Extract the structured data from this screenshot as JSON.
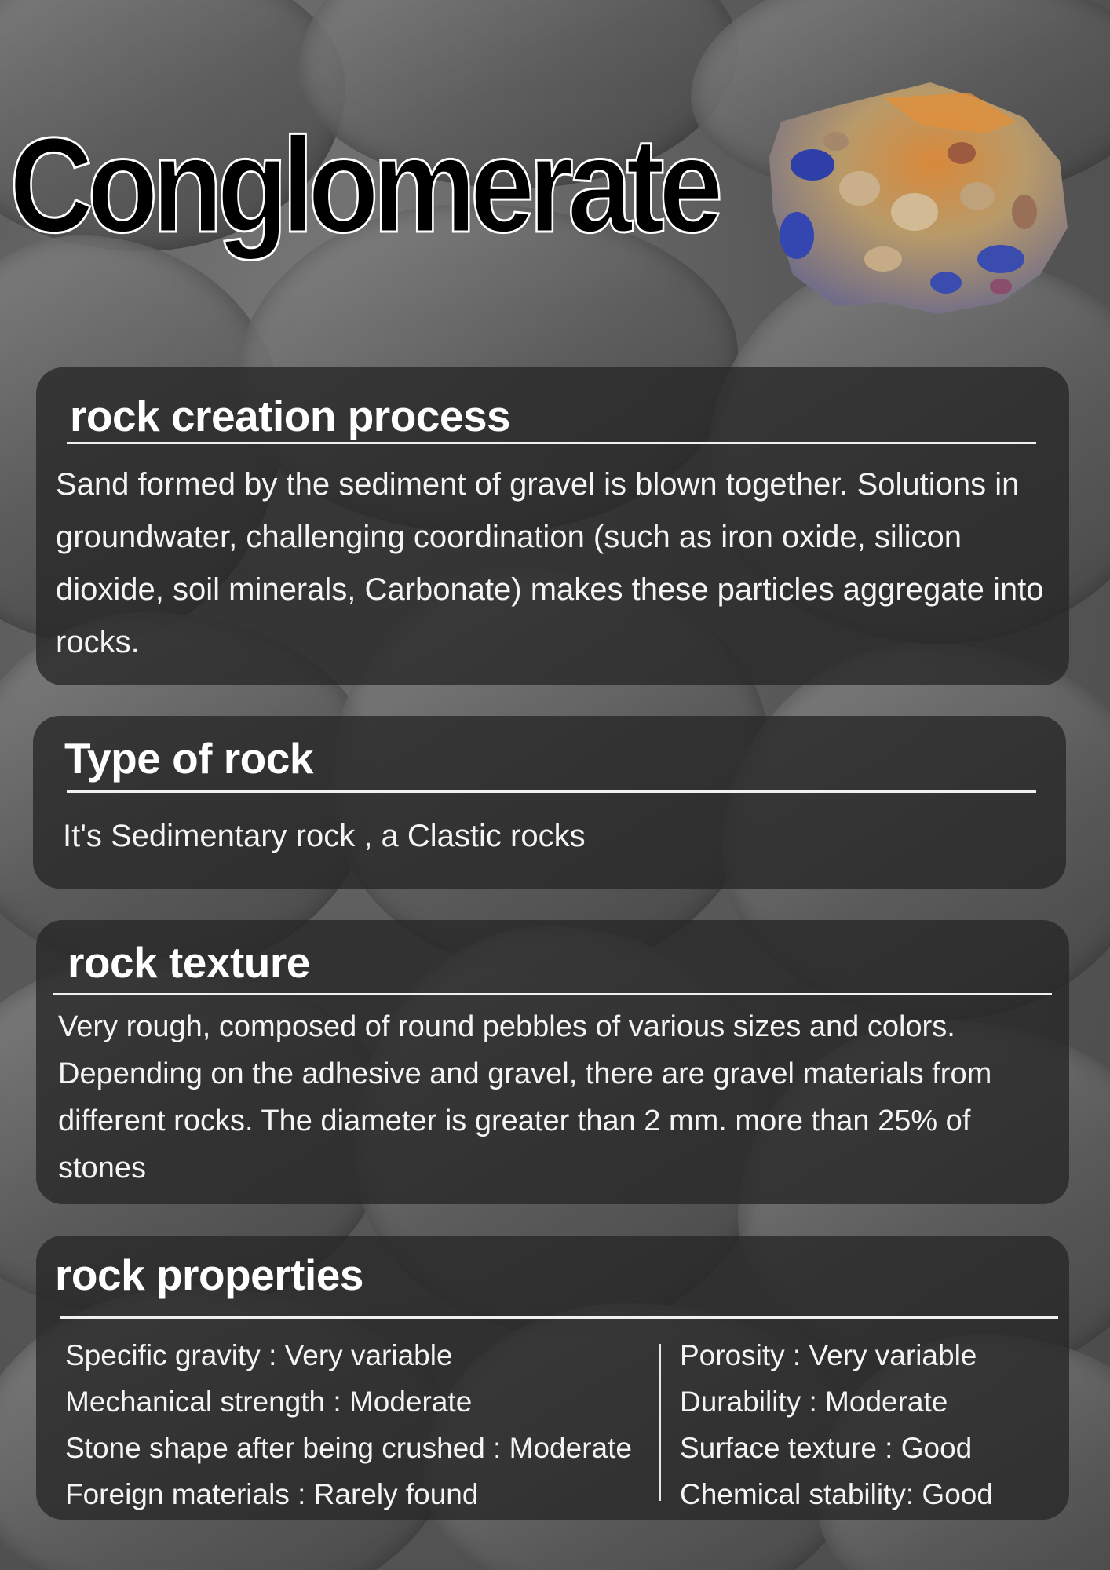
{
  "title": "Conglomerate",
  "sections": {
    "creation": {
      "heading": "rock creation process",
      "body": "Sand formed by the sediment of gravel is blown together. Solutions in groundwater, challenging coordination (such as iron oxide, silicon dioxide, soil minerals, Carbonate) makes these particles aggregate into rocks."
    },
    "type": {
      "heading": "Type of rock",
      "body": "It's Sedimentary rock , a Clastic rocks"
    },
    "texture": {
      "heading": "rock texture",
      "body": "Very rough, composed of round pebbles of various sizes and colors. Depending  on the adhesive and gravel, there are gravel materials from different rocks. The diameter is greater than 2 mm. more than 25% of stones"
    },
    "properties": {
      "heading": "rock properties",
      "left": [
        "Specific gravity : Very variable",
        "Mechanical strength : Moderate",
        "Stone shape after being crushed : Moderate",
        "Foreign materials : Rarely found"
      ],
      "right": [
        "Porosity : Very variable",
        "Durability : Moderate",
        "Surface texture : Good",
        "Chemical stability: Good"
      ]
    }
  },
  "colors": {
    "panel": "#262626",
    "text": "#f4f4f4",
    "title_fill": "#000000",
    "title_stroke": "#ffffff"
  }
}
